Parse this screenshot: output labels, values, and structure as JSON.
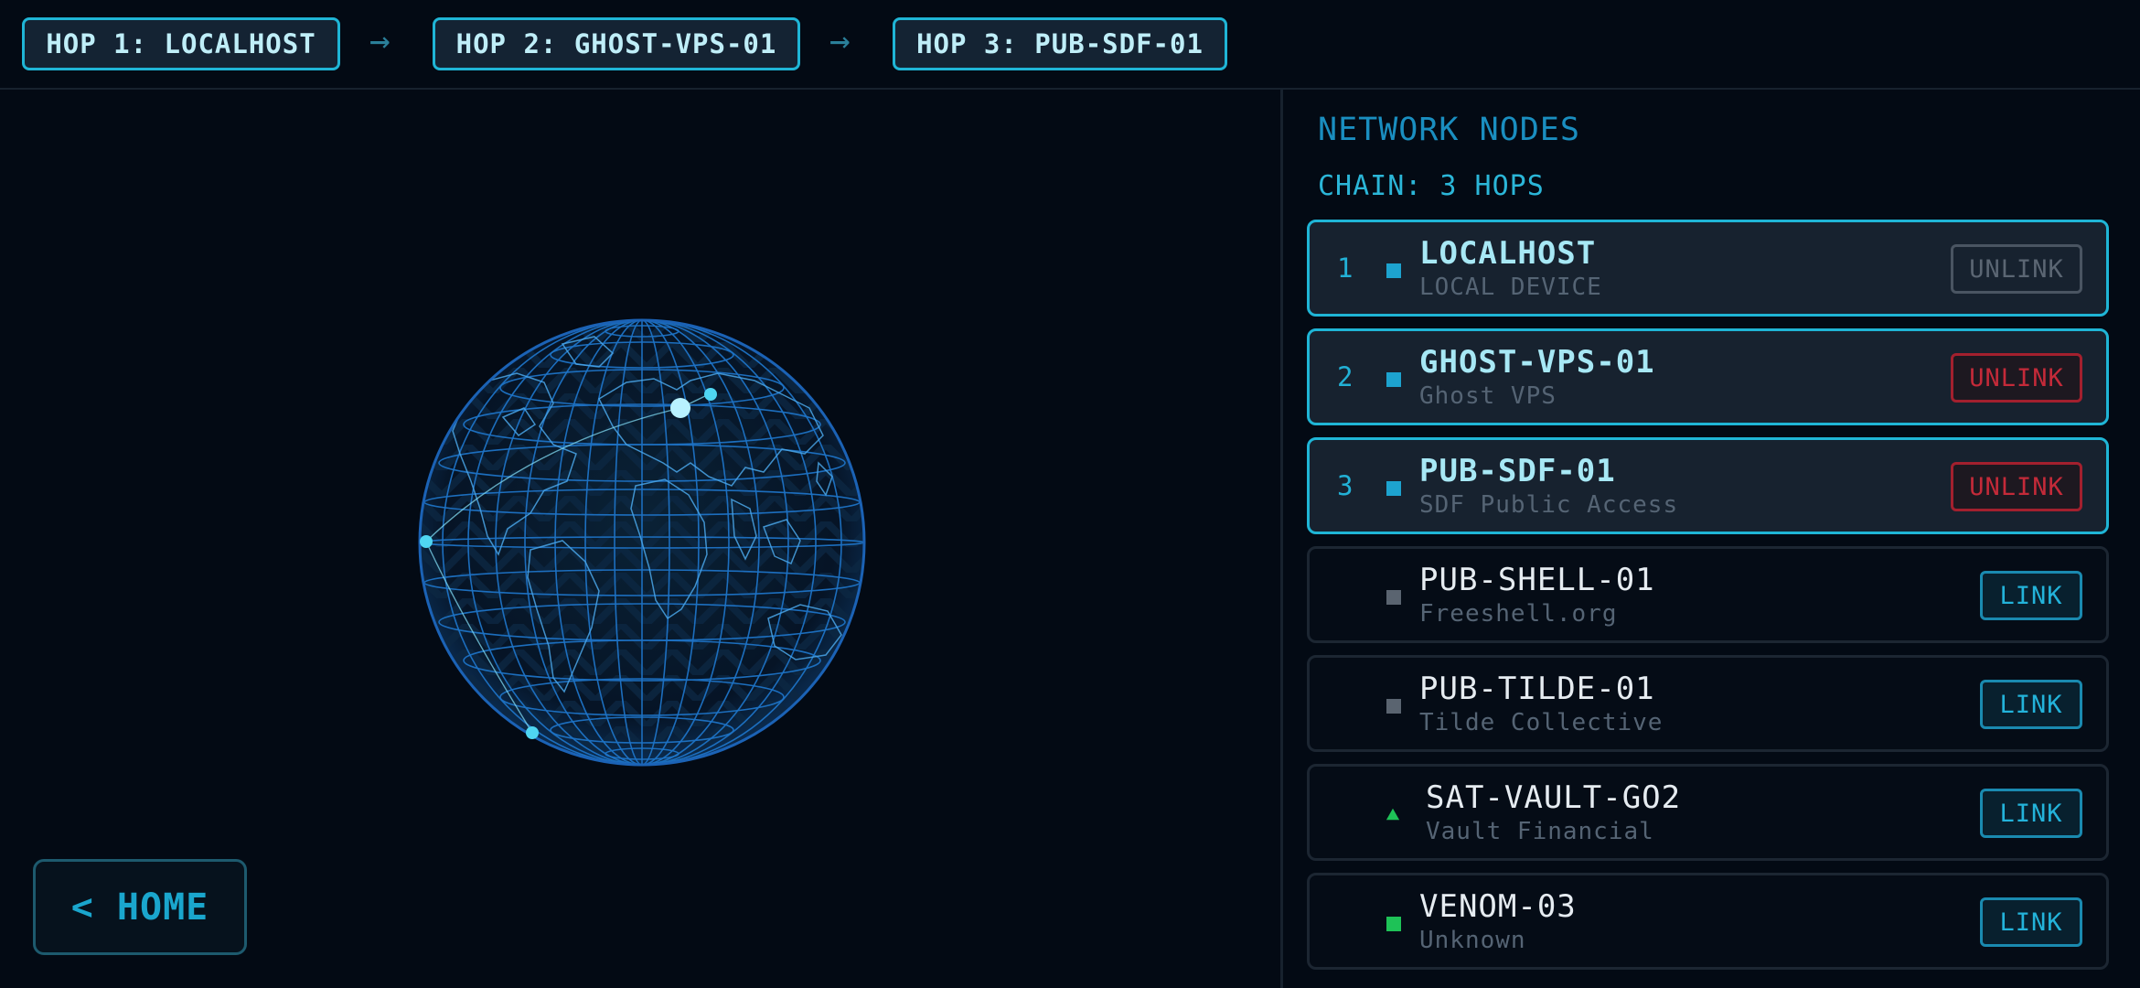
{
  "hops": [
    {
      "label": "HOP 1: LOCALHOST"
    },
    {
      "label": "HOP 2: GHOST-VPS-01"
    },
    {
      "label": "HOP 3: PUB-SDF-01"
    }
  ],
  "hop_separator": "→",
  "home_button": "< HOME",
  "panel": {
    "title": "NETWORK NODES",
    "chain_info": "CHAIN: 3 HOPS"
  },
  "nodes": [
    {
      "index": "1",
      "name": "LOCALHOST",
      "desc": "LOCAL DEVICE",
      "action": "UNLINK",
      "status_icon": "square",
      "status_color": "#1da3cf"
    },
    {
      "index": "2",
      "name": "GHOST-VPS-01",
      "desc": "Ghost VPS",
      "action": "UNLINK",
      "status_icon": "square",
      "status_color": "#1da3cf"
    },
    {
      "index": "3",
      "name": "PUB-SDF-01",
      "desc": "SDF Public Access",
      "action": "UNLINK",
      "status_icon": "square",
      "status_color": "#1da3cf"
    },
    {
      "index": "",
      "name": "PUB-SHELL-01",
      "desc": "Freeshell.org",
      "action": "LINK",
      "status_icon": "square",
      "status_color": "#5a6470"
    },
    {
      "index": "",
      "name": "PUB-TILDE-01",
      "desc": "Tilde Collective",
      "action": "LINK",
      "status_icon": "square",
      "status_color": "#5a6470"
    },
    {
      "index": "",
      "name": "SAT-VAULT-GO2",
      "desc": "Vault Financial",
      "action": "LINK",
      "status_icon": "triangle",
      "status_color": "#1ec257"
    },
    {
      "index": "",
      "name": "VENOM-03",
      "desc": "Unknown",
      "action": "LINK",
      "status_icon": "square",
      "status_color": "#1ec257"
    }
  ],
  "colors": {
    "accent": "#1fb5d6",
    "danger": "#c42a39",
    "background": "#030a14"
  }
}
